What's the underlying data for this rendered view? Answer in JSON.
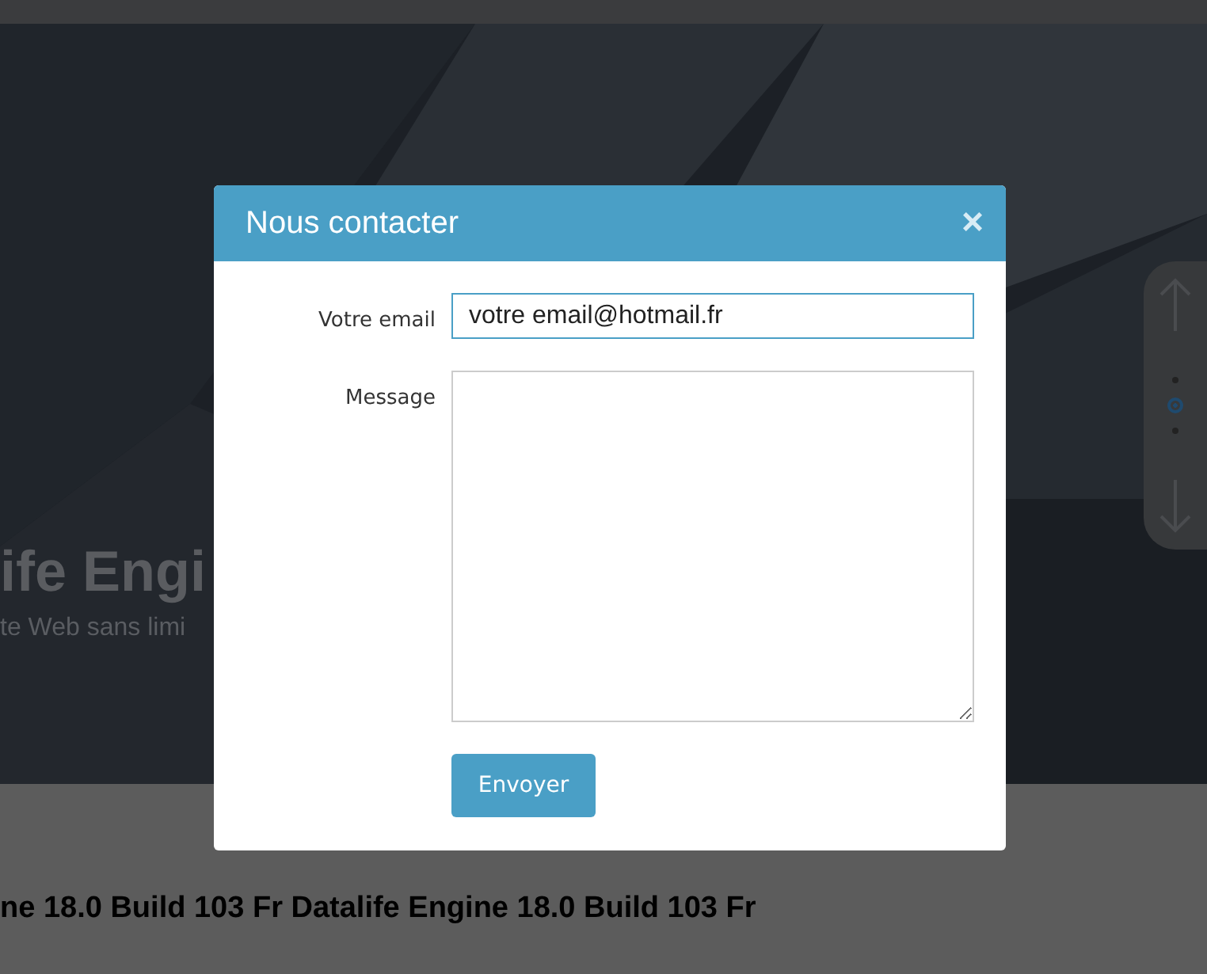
{
  "hero": {
    "title": "ife Engi",
    "subtitle": "te Web sans limi",
    "slider_nav": {
      "dots": [
        {
          "selected": false
        },
        {
          "selected": true
        },
        {
          "selected": false
        }
      ]
    }
  },
  "headline": "ne 18.0 Build 103 Fr Datalife Engine 18.0 Build 103 Fr",
  "dialog": {
    "title": "Nous contacter",
    "close": "×",
    "fields": [
      {
        "kind": "input",
        "label": "Votre email",
        "value": "votre email@hotmail.fr"
      },
      {
        "kind": "textarea",
        "label": "Message"
      }
    ],
    "submit": "Envoyer"
  }
}
